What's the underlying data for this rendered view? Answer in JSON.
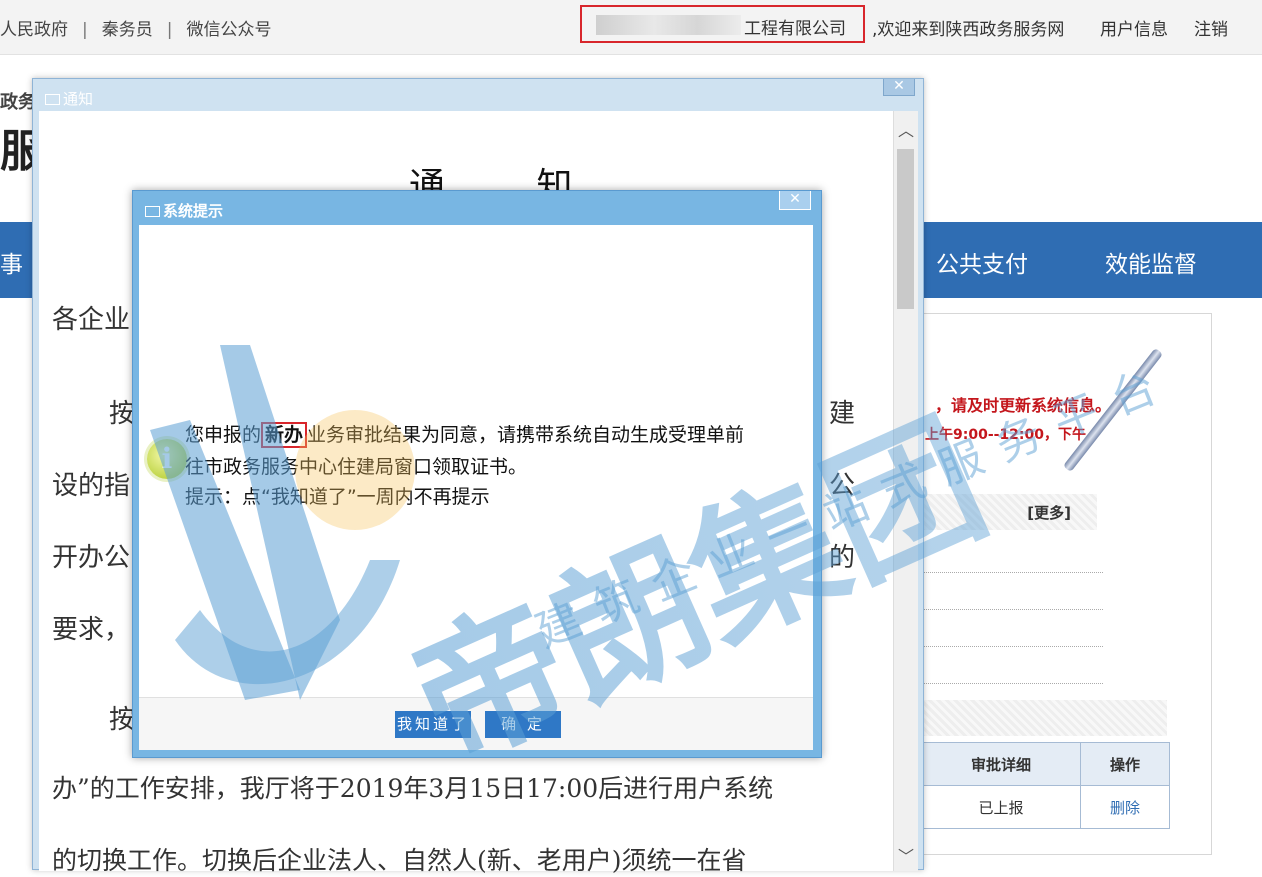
{
  "topbar": {
    "links": [
      "人民政府",
      "秦务员",
      "微信公众号"
    ],
    "company_suffix": "工程有限公司",
    "welcome": ",欢迎来到陕西政务服务网",
    "user_info": "用户信息",
    "logout": "注销"
  },
  "site": {
    "subtitle": "政务服务平台",
    "title_char": "服"
  },
  "nav": {
    "items": [
      "事",
      "公共支付",
      "效能监督"
    ]
  },
  "right_panel": {
    "notice_red": "，请及时更新系统信息。",
    "notice_hours": "上午9:00--12:00，下午",
    "more_link": "[更多]",
    "table_headers": [
      "审批详细",
      "操作"
    ],
    "table_row": [
      "已上报",
      "删除"
    ]
  },
  "notice_window": {
    "title": "通知",
    "heading": "通 知",
    "lines": [
      "各企业",
      "按",
      "建",
      "设的指",
      "公",
      "开办公",
      "的",
      "要求，",
      "按",
      "办”的工作安排，我厅将于2019年3月15日17:00后进行用户系统",
      "的切换工作。切换后企业法人、自然人(新、老用户)须统一在省"
    ]
  },
  "system_dialog": {
    "title": "系统提示",
    "message_prefix": "您申报的",
    "message_highlight": "新办",
    "message_suffix": "业务审批结果为同意，请携带系统自动生成受理单前",
    "message_line2": "往市政务服务中心住建局窗口领取证书。",
    "message_line3": "提示：点“我知道了”一周内不再提示",
    "btn_know": "我知道了",
    "btn_ok": "确 定"
  },
  "watermark": {
    "main": "帝朗集团",
    "sub": "建筑企业一站式服务平台"
  },
  "colors": {
    "accent": "#2f6db3",
    "dialog_frame": "#78b6e3",
    "highlight": "#d8262c",
    "button": "#2f78c6"
  }
}
